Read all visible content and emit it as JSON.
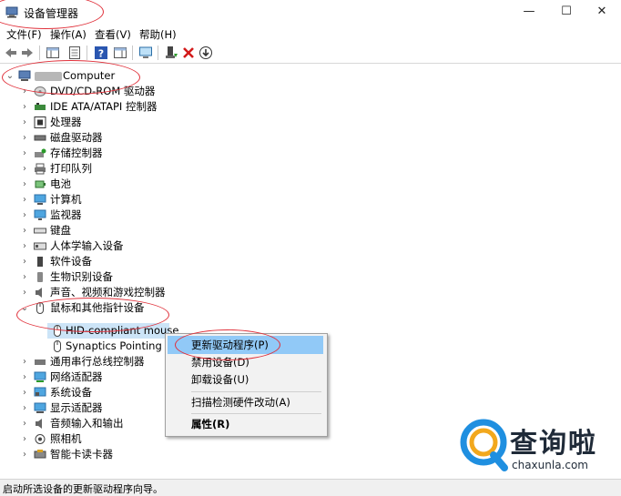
{
  "window": {
    "title": "设备管理器",
    "controls": {
      "minimize": "—",
      "maximize": "☐",
      "close": "✕"
    }
  },
  "menu": [
    "文件(F)",
    "操作(A)",
    "查看(V)",
    "帮助(H)"
  ],
  "toolbar": [
    "back-icon",
    "forward-icon",
    "show-hide-console-tree-icon",
    "properties-icon",
    "help-icon",
    "action-pane-icon",
    "scan-hardware-icon",
    "update-driver-icon",
    "uninstall-icon",
    "disable-device-icon"
  ],
  "tree": {
    "root": "Computer",
    "categories": [
      "DVD/CD-ROM 驱动器",
      "IDE ATA/ATAPI 控制器",
      "处理器",
      "磁盘驱动器",
      "存储控制器",
      "打印队列",
      "电池",
      "计算机",
      "监视器",
      "键盘",
      "人体学输入设备",
      "软件设备",
      "生物识别设备",
      "声音、视频和游戏控制器",
      "鼠标和其他指针设备"
    ],
    "children": [
      "HID-compliant mouse",
      "Synaptics Pointing De"
    ],
    "more_categories": [
      "通用串行总线控制器",
      "网络适配器",
      "系统设备",
      "显示适配器",
      "音频输入和输出",
      "照相机",
      "智能卡读卡器"
    ]
  },
  "context_menu": {
    "update": "更新驱动程序(P)",
    "disable": "禁用设备(D)",
    "uninstall": "卸载设备(U)",
    "scan": "扫描检测硬件改动(A)",
    "properties": "属性(R)"
  },
  "status": "启动所选设备的更新驱动程序向导。",
  "watermark": {
    "brand": "查询啦",
    "domain": "chaxunla.com"
  },
  "colors": {
    "selection": "#cce4f7",
    "menu_highlight": "#91c9f7",
    "annotation": "#e0303a",
    "watermark_blue": "#1f8fe0"
  }
}
